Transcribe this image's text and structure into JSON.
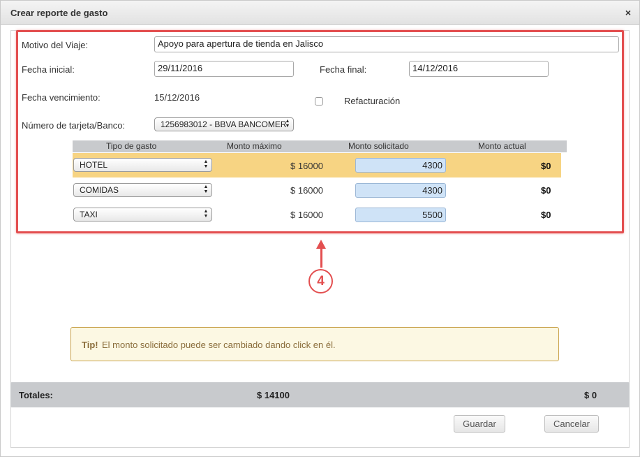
{
  "dialog": {
    "title": "Crear reporte de gasto",
    "close_icon": "×"
  },
  "form": {
    "motivo_label": "Motivo del Viaje:",
    "motivo_value": "Apoyo para apertura de tienda en Jalisco",
    "fecha_inicial_label": "Fecha inicial:",
    "fecha_inicial_value": "29/11/2016",
    "fecha_final_label": "Fecha final:",
    "fecha_final_value": "14/12/2016",
    "vencimiento_label": "Fecha vencimiento:",
    "vencimiento_value": "15/12/2016",
    "refacturacion_label": "Refacturación",
    "refacturacion_checked": false,
    "tarjeta_label": "Número de tarjeta/Banco:",
    "tarjeta_value": "1256983012 - BBVA BANCOMER"
  },
  "table": {
    "headers": [
      "Tipo de gasto",
      "Monto máximo",
      "Monto solicitado",
      "Monto actual"
    ],
    "rows": [
      {
        "tipo": "HOTEL",
        "maximo": "$ 16000",
        "solicitado": "4300",
        "actual": "$0",
        "highlighted": true
      },
      {
        "tipo": "COMIDAS",
        "maximo": "$ 16000",
        "solicitado": "4300",
        "actual": "$0",
        "highlighted": false
      },
      {
        "tipo": "TAXI",
        "maximo": "$ 16000",
        "solicitado": "5500",
        "actual": "$0",
        "highlighted": false
      }
    ]
  },
  "annotation": {
    "step": "4",
    "color": "#e34f50"
  },
  "tip": {
    "strong": "Tip!",
    "text": "El monto solicitado puede ser cambiado dando click en él."
  },
  "totals": {
    "label": "Totales:",
    "solicitado": "$ 14100",
    "actual": "$ 0"
  },
  "buttons": {
    "save": "Guardar",
    "cancel": "Cancelar"
  },
  "icons": {
    "close": "close-icon",
    "select_arrows": "chevron-updown-icon"
  }
}
